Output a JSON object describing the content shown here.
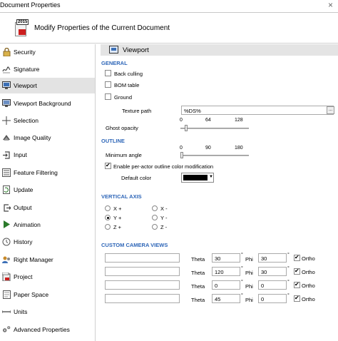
{
  "window": {
    "title": "Document Properties",
    "close_glyph": "×"
  },
  "header": {
    "heading": "Modify Properties of the Current Document",
    "icon_year": "2015"
  },
  "sidebar": {
    "items": [
      {
        "label": "Security",
        "icon": "lock-icon"
      },
      {
        "label": "Signature",
        "icon": "signature-icon"
      },
      {
        "label": "Viewport",
        "icon": "viewport-icon",
        "active": true
      },
      {
        "label": "Viewport Background",
        "icon": "viewport-background-icon"
      },
      {
        "label": "Selection",
        "icon": "crosshair-icon"
      },
      {
        "label": "Image Quality",
        "icon": "image-quality-icon"
      },
      {
        "label": "Input",
        "icon": "input-icon"
      },
      {
        "label": "Feature Filtering",
        "icon": "filter-icon"
      },
      {
        "label": "Update",
        "icon": "update-icon"
      },
      {
        "label": "Output",
        "icon": "output-icon"
      },
      {
        "label": "Animation",
        "icon": "play-icon"
      },
      {
        "label": "History",
        "icon": "history-icon"
      },
      {
        "label": "Right Manager",
        "icon": "right-manager-icon"
      },
      {
        "label": "Project",
        "icon": "project-icon"
      },
      {
        "label": "Paper Space",
        "icon": "paper-space-icon"
      },
      {
        "label": "Units",
        "icon": "units-icon"
      },
      {
        "label": "Advanced Properties",
        "icon": "gears-icon"
      }
    ]
  },
  "panel": {
    "title": "Viewport"
  },
  "general": {
    "title": "GENERAL",
    "back_culling": {
      "label": "Back culling",
      "checked": false
    },
    "bom_table": {
      "label": "BOM table",
      "checked": false
    },
    "ground": {
      "label": "Ground",
      "checked": false
    },
    "texture_path": {
      "label": "Texture path",
      "value": "%DS%",
      "browse": "..."
    },
    "ghost_opacity": {
      "label": "Ghost opacity",
      "min": "0",
      "mid": "64",
      "max": "128",
      "value": 0
    }
  },
  "outline": {
    "title": "OUTLINE",
    "minimum_angle": {
      "label": "Minimum angle",
      "min": "0",
      "mid": "90",
      "max": "180",
      "value": 0
    },
    "per_actor": {
      "label": "Enable per-actor outline color modification",
      "checked": true
    },
    "default_color": {
      "label": "Default color",
      "value": "#000000"
    }
  },
  "vertical_axis": {
    "title": "VERTICAL AXIS",
    "options": [
      {
        "label": "X +",
        "checked": false
      },
      {
        "label": "X -",
        "checked": false
      },
      {
        "label": "Y +",
        "checked": true
      },
      {
        "label": "Y -",
        "checked": false
      },
      {
        "label": "Z +",
        "checked": false
      },
      {
        "label": "Z -",
        "checked": false
      }
    ]
  },
  "camera_views": {
    "title": "CUSTOM CAMERA VIEWS",
    "theta_label": "Theta",
    "phi_label": "Phi",
    "degree_symbol": "°",
    "ortho_label": "Ortho",
    "rows": [
      {
        "name": "",
        "theta": "30",
        "phi": "30",
        "ortho": true
      },
      {
        "name": "",
        "theta": "120",
        "phi": "30",
        "ortho": true
      },
      {
        "name": "",
        "theta": "0",
        "phi": "0",
        "ortho": true
      },
      {
        "name": "",
        "theta": "45",
        "phi": "0",
        "ortho": true
      }
    ]
  }
}
